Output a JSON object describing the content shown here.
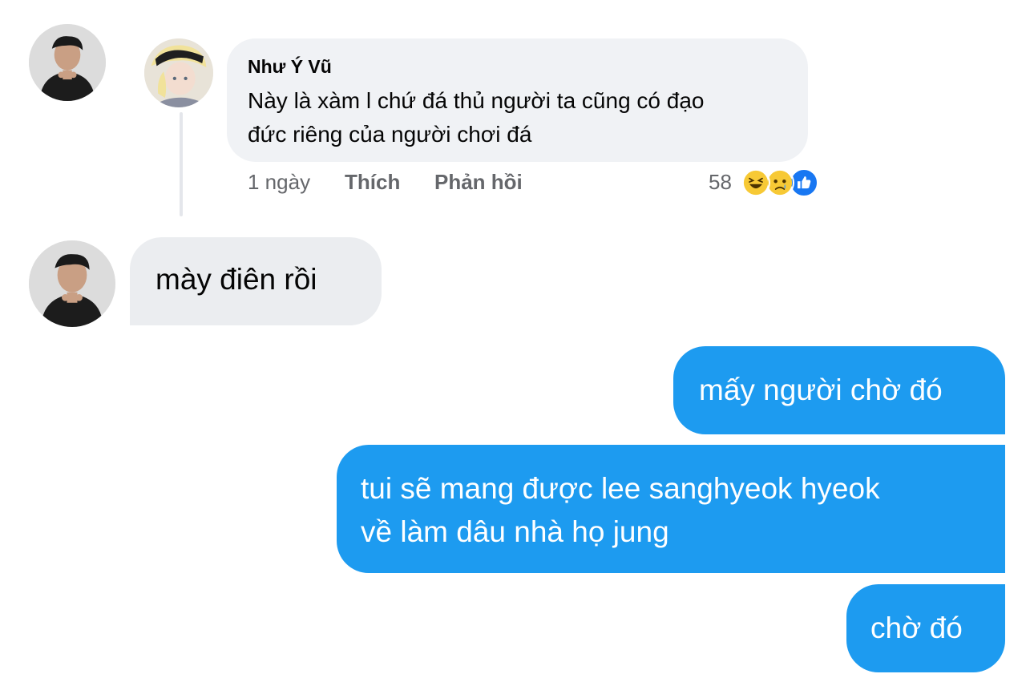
{
  "fb_comment": {
    "author": "Như Ý Vũ",
    "text_line1": "Này là xàm l chứ đá thủ người ta cũng có đạo",
    "text_line2": "đức riêng của người chơi đá",
    "time": "1 ngày",
    "like_label": "Thích",
    "reply_label": "Phản hồi",
    "reaction_count": "58",
    "reactions": [
      "haha-icon",
      "sad-icon",
      "like-icon"
    ]
  },
  "messages": [
    {
      "sender": "other",
      "text": "mày điên rồi"
    },
    {
      "sender": "me",
      "text": "mấy người chờ đó"
    },
    {
      "sender": "me",
      "text_line1": "tui sẽ mang được lee sanghyeok hyeok",
      "text_line2": "về làm dâu nhà họ jung"
    },
    {
      "sender": "me",
      "text": "chờ đó"
    }
  ],
  "colors": {
    "outgoing_bubble": "#1d9bf0",
    "incoming_bubble": "#ebedf0",
    "comment_bubble": "#f0f2f5"
  }
}
